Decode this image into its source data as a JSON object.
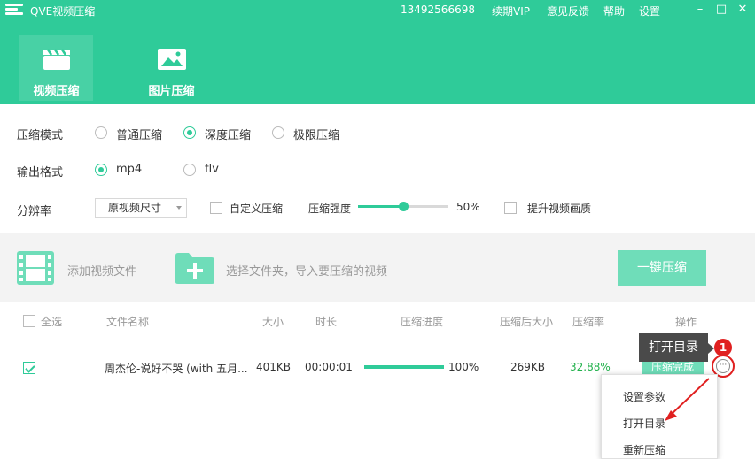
{
  "titlebar": {
    "app_title": "QVE视频压缩",
    "phone": "13492566698",
    "links": [
      "续期VIP",
      "意见反馈",
      "帮助",
      "设置"
    ],
    "minimize": "–",
    "maximize": "□",
    "close": "✕"
  },
  "tabs": [
    {
      "label": "视频压缩",
      "icon": "clapperboard-icon",
      "active": true
    },
    {
      "label": "图片压缩",
      "icon": "image-icon",
      "active": false
    }
  ],
  "settings": {
    "mode_label": "压缩模式",
    "mode_options": [
      "普通压缩",
      "深度压缩",
      "极限压缩"
    ],
    "mode_selected": "深度压缩",
    "format_label": "输出格式",
    "format_options": [
      "mp4",
      "flv"
    ],
    "format_selected": "mp4",
    "resolution_label": "分辨率",
    "resolution_value": "原视频尺寸",
    "custom_label": "自定义压缩",
    "strength_label": "压缩强度",
    "strength_value": "50%",
    "strength_fraction": 0.5,
    "enhance_label": "提升视频画质"
  },
  "actions": {
    "add_file": "添加视频文件",
    "choose_folder": "选择文件夹，导入要压缩的视频",
    "one_click": "一键压缩"
  },
  "table": {
    "select_all": "全选",
    "headers": [
      "文件名称",
      "大小",
      "时长",
      "压缩进度",
      "压缩后大小",
      "压缩率",
      "操作"
    ],
    "row": {
      "name": "周杰伦-说好不哭 (with 五月...",
      "size": "401KB",
      "duration": "00:00:01",
      "progress": "100%",
      "progress_fraction": 1.0,
      "compressed_size": "269KB",
      "ratio": "32.88%",
      "status": "压缩完成",
      "more": "···"
    }
  },
  "tooltip": "打开目录",
  "badge": "1",
  "menu": [
    "设置参数",
    "打开目录",
    "重新压缩"
  ],
  "colors": {
    "brand": "#2fcb99",
    "ratio": "#22b14c",
    "annotation": "#e02020"
  }
}
